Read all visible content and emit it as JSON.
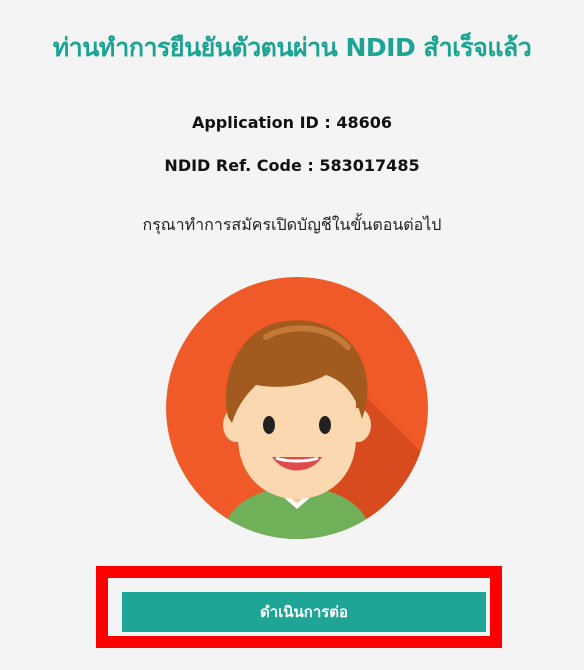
{
  "header": {
    "title": "ท่านทำการยืนยันตัวตนผ่าน NDID สำเร็จแล้ว"
  },
  "info": {
    "application_id": "Application ID : 48606",
    "ndid_ref_code": "NDID Ref. Code : 583017485"
  },
  "instruction": "กรุณาทำการสมัครเปิดบัญชีในขั้นตอนต่อไป",
  "avatar": {
    "icon": "user-avatar-icon",
    "background_color": "#f05a28",
    "shadow_color": "#d84b1e",
    "hair_color": "#a35a1f",
    "skin_color": "#fbd8b0",
    "shirt_color": "#6fb059"
  },
  "actions": {
    "continue_label": "ดำเนินการต่อ"
  },
  "colors": {
    "accent": "#1ba393",
    "button": "#1fa595",
    "highlight": "#ff0000"
  }
}
